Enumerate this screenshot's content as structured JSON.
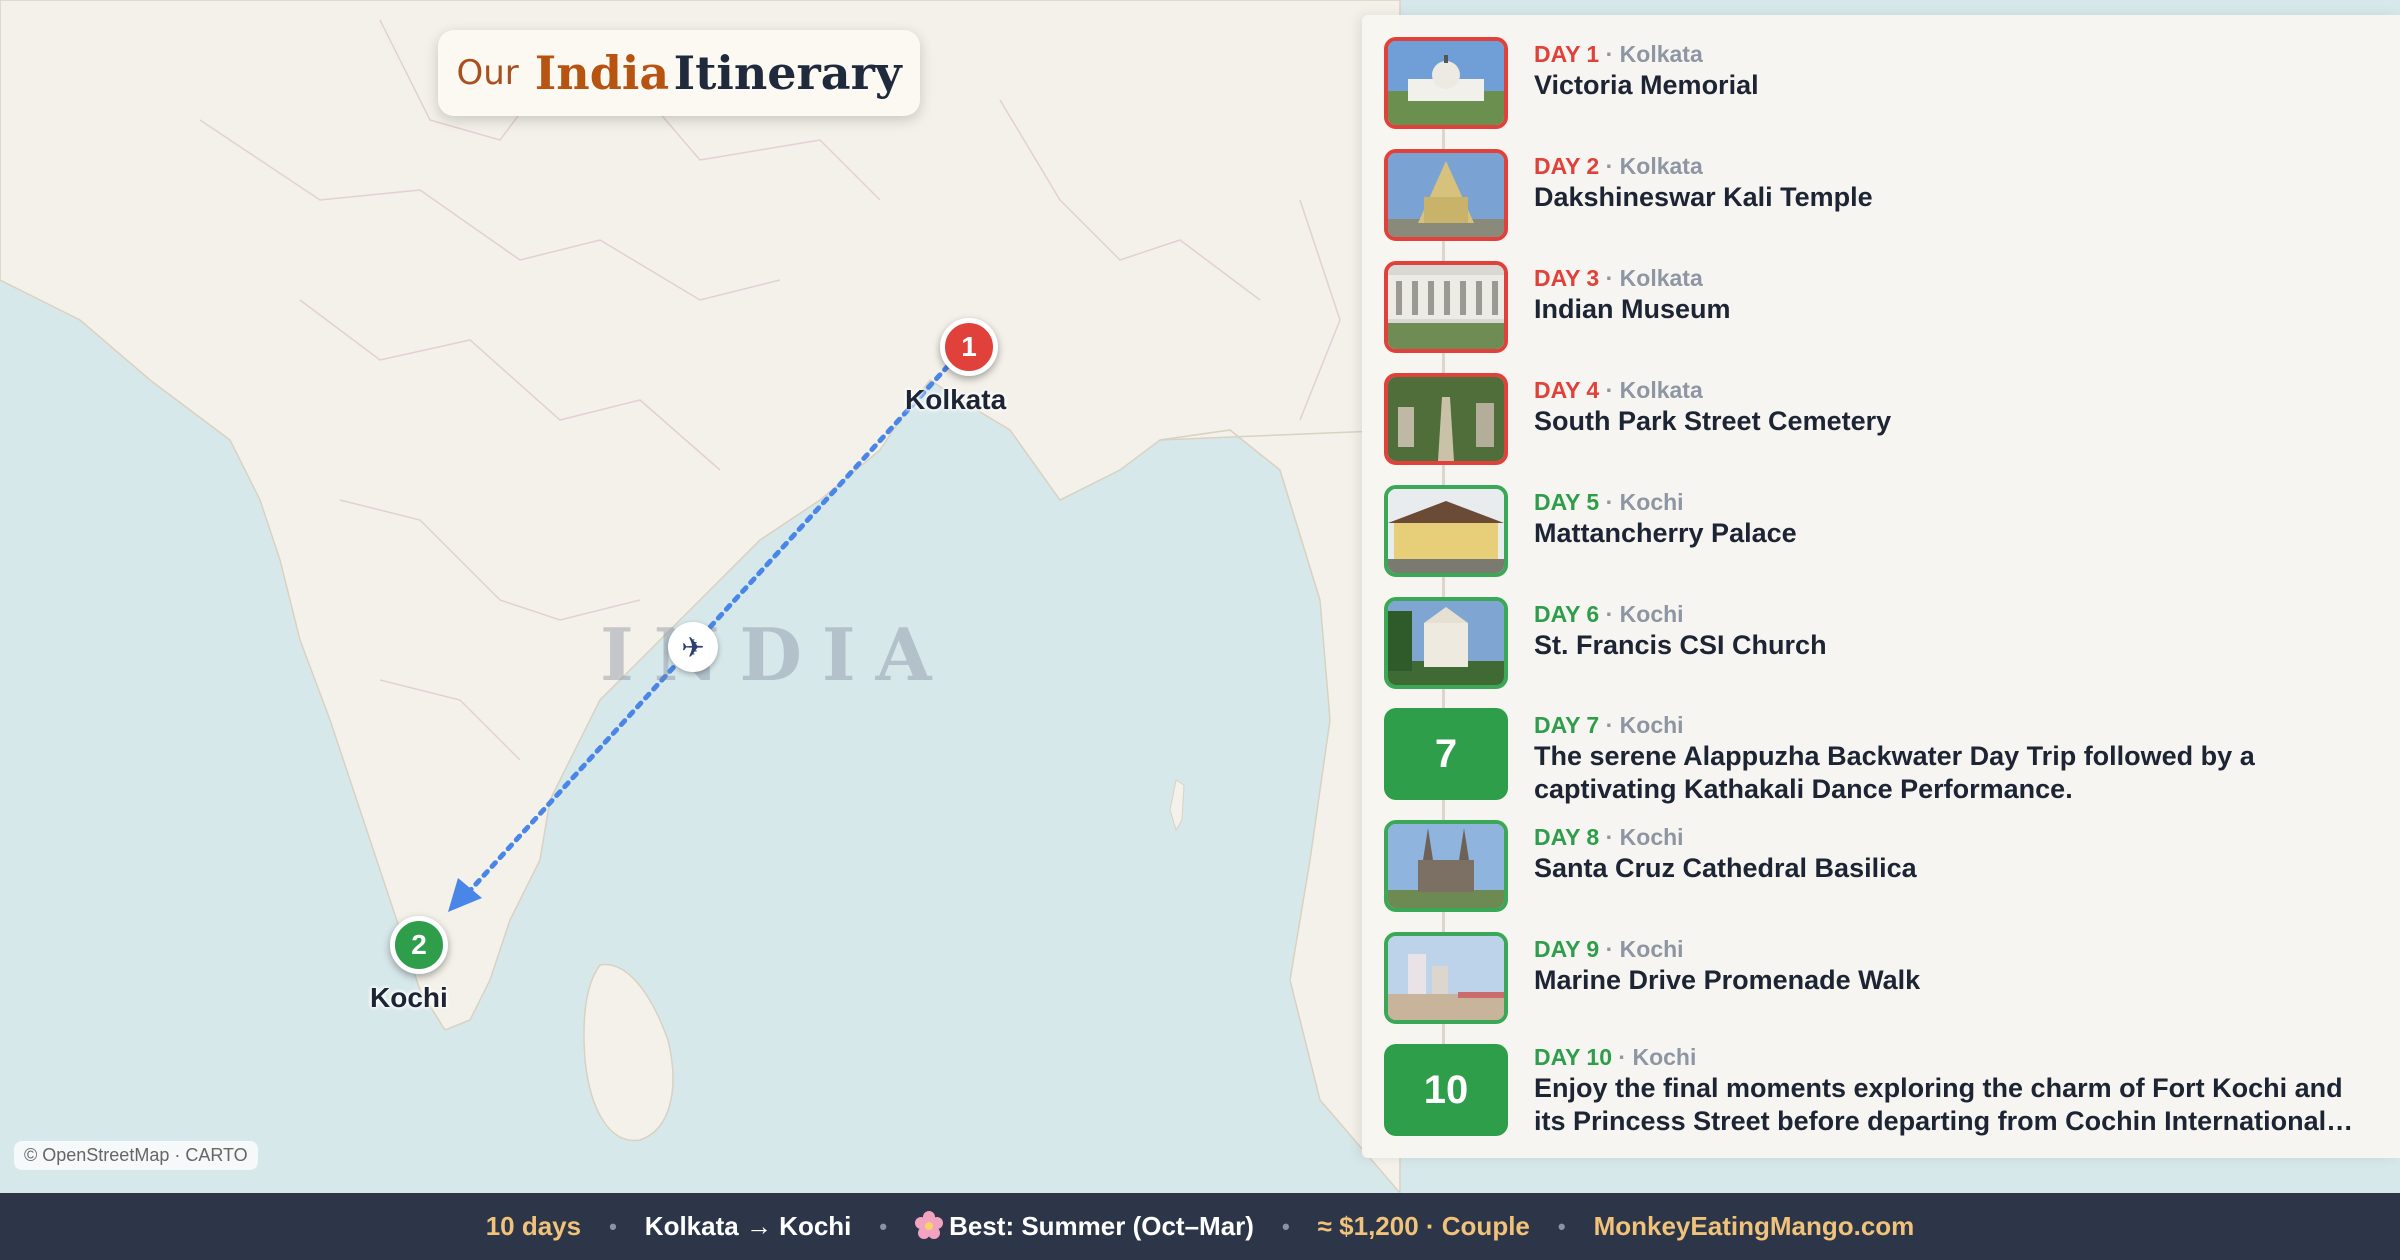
{
  "title": {
    "our": "Our",
    "india": "India",
    "itinerary": "Itinerary"
  },
  "map": {
    "country_label": "INDIA",
    "attribution": "© OpenStreetMap · CARTO",
    "route_mode_icon": "airplane-icon",
    "stops": [
      {
        "number": "1",
        "city": "Kolkata",
        "color": "#e0413a"
      },
      {
        "number": "2",
        "city": "Kochi",
        "color": "#2e9e4b"
      }
    ]
  },
  "days": [
    {
      "day": "DAY 1",
      "city": "Kolkata",
      "title": "Victoria Memorial",
      "thumb": "photo"
    },
    {
      "day": "DAY 2",
      "city": "Kolkata",
      "title": "Dakshineswar Kali Temple",
      "thumb": "photo"
    },
    {
      "day": "DAY 3",
      "city": "Kolkata",
      "title": "Indian Museum",
      "thumb": "photo"
    },
    {
      "day": "DAY 4",
      "city": "Kolkata",
      "title": "South Park Street Cemetery",
      "thumb": "photo"
    },
    {
      "day": "DAY 5",
      "city": "Kochi",
      "title": "Mattancherry Palace",
      "thumb": "photo"
    },
    {
      "day": "DAY 6",
      "city": "Kochi",
      "title": "St. Francis CSI Church",
      "thumb": "photo"
    },
    {
      "day": "DAY 7",
      "city": "Kochi",
      "title": "The serene Alappuzha Backwater Day Trip followed by a captivating Kathakali Dance Performance.",
      "thumb": "7"
    },
    {
      "day": "DAY 8",
      "city": "Kochi",
      "title": "Santa Cruz Cathedral Basilica",
      "thumb": "photo"
    },
    {
      "day": "DAY 9",
      "city": "Kochi",
      "title": "Marine Drive Promenade Walk",
      "thumb": "photo"
    },
    {
      "day": "DAY 10",
      "city": "Kochi",
      "title": "Enjoy the final moments exploring the charm of Fort Kochi and its Princess Street before departing from Cochin International…",
      "thumb": "10"
    }
  ],
  "footer": {
    "duration": "10 days",
    "route": "Kolkata → Kochi",
    "season": "Best: Summer (Oct–Mar)",
    "budget": "≈ $1,200 · Couple",
    "site": "MonkeyEatingMango.com",
    "separator": "•"
  },
  "colors": {
    "kolkata": "#e0413a",
    "kochi": "#2e9e4b",
    "route": "#4a86e8",
    "footer_bg": "#2c3648",
    "footer_accent": "#f0c27a"
  }
}
